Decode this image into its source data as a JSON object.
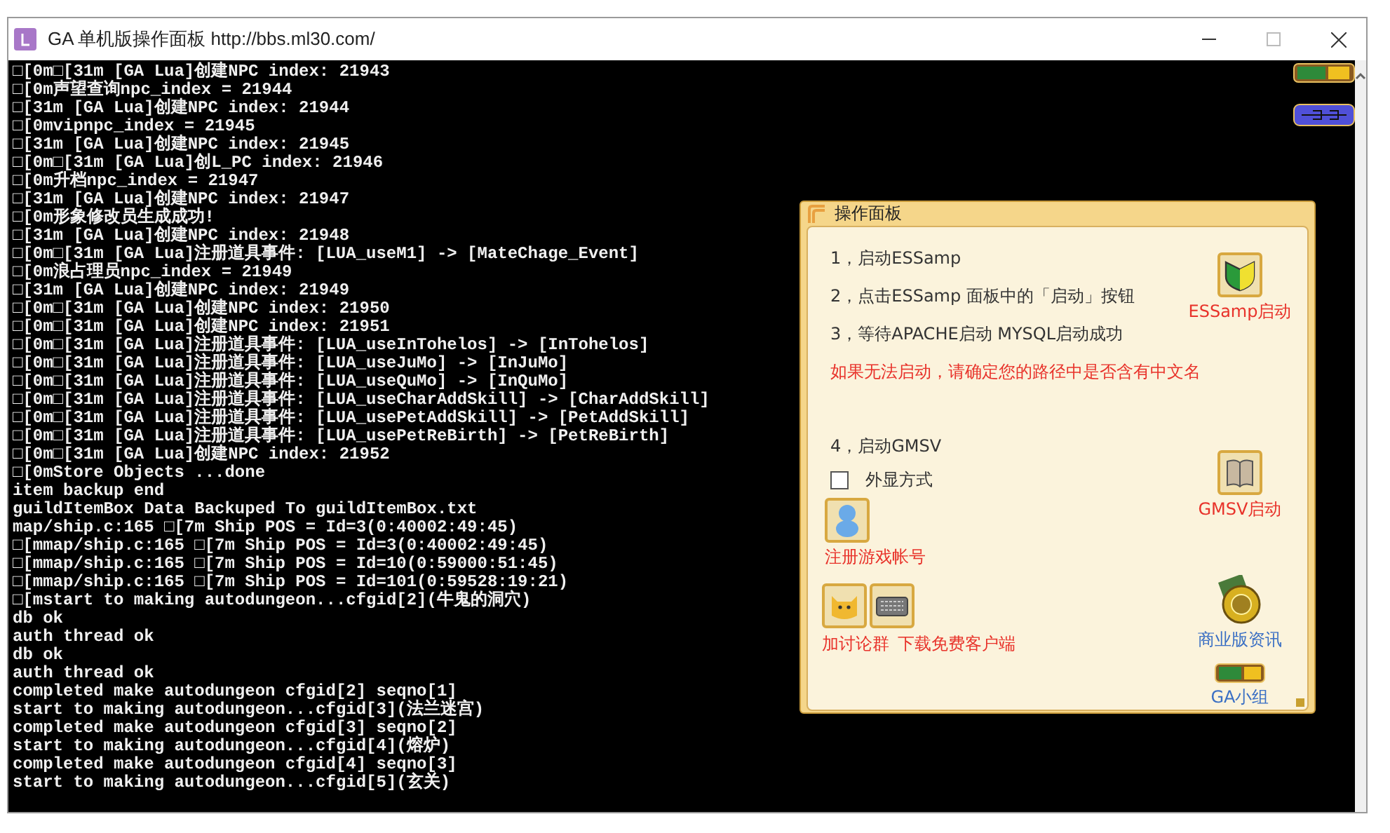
{
  "window": {
    "title": "GA 单机版操作面板 http://bbs.ml30.com/"
  },
  "console": {
    "lines": [
      "□[0m□[31m [GA Lua]创建NPC index: 21943",
      "□[0m声望查询npc_index = 21944",
      "□[31m [GA Lua]创建NPC index: 21944",
      "□[0mvipnpc_index = 21945",
      "□[31m [GA Lua]创建NPC index: 21945",
      "□[0m□[31m [GA Lua]创L_PC index: 21946",
      "□[0m升档npc_index = 21947",
      "□[31m [GA Lua]创建NPC index: 21947",
      "□[0m形象修改员生成成功!",
      "□[31m [GA Lua]创建NPC index: 21948",
      "□[0m□[31m [GA Lua]注册道具事件: [LUA_useM1] -> [MateChage_Event]",
      "□[0m浪占理员npc_index = 21949",
      "□[31m [GA Lua]创建NPC index: 21949",
      "□[0m□[31m [GA Lua]创建NPC index: 21950",
      "□[0m□[31m [GA Lua]创建NPC index: 21951",
      "□[0m□[31m [GA Lua]注册道具事件: [LUA_useInTohelos] -> [InTohelos]",
      "□[0m□[31m [GA Lua]注册道具事件: [LUA_useJuMo] -> [InJuMo]",
      "□[0m□[31m [GA Lua]注册道具事件: [LUA_useQuMo] -> [InQuMo]",
      "□[0m□[31m [GA Lua]注册道具事件: [LUA_useCharAddSkill] -> [CharAddSkill]",
      "□[0m□[31m [GA Lua]注册道具事件: [LUA_usePetAddSkill] -> [PetAddSkill]",
      "□[0m□[31m [GA Lua]注册道具事件: [LUA_usePetReBirth] -> [PetReBirth]",
      "□[0m□[31m [GA Lua]创建NPC index: 21952",
      "□[0mStore Objects ...done",
      "item backup end",
      "guildItemBox Data Backuped To guildItemBox.txt",
      "map/ship.c:165 □[7m Ship POS = Id=3(0:40002:49:45)",
      "□[mmap/ship.c:165 □[7m Ship POS = Id=3(0:40002:49:45)",
      "□[mmap/ship.c:165 □[7m Ship POS = Id=10(0:59000:51:45)",
      "□[mmap/ship.c:165 □[7m Ship POS = Id=101(0:59528:19:21)",
      "□[mstart to making autodungeon...cfgid[2](牛鬼的洞穴)",
      "db ok",
      "auth thread ok",
      "db ok",
      "auth thread ok",
      "completed make autodungeon cfgid[2] seqno[1]",
      "start to making autodungeon...cfgid[3](法兰迷宫)",
      "completed make autodungeon cfgid[3] seqno[2]",
      "start to making autodungeon...cfgid[4](熔炉)",
      "completed make autodungeon cfgid[4] seqno[3]",
      "start to making autodungeon...cfgid[5](玄关)"
    ]
  },
  "panel": {
    "title": "操作面板",
    "steps": [
      "1，启动ESSamp",
      "2，点击ESSamp 面板中的「启动」按钮",
      "3，等待APACHE启动 MYSQL启动成功"
    ],
    "warning": "如果无法启动，请确定您的路径中是否含有中文名",
    "step4": "4，启动GMSV",
    "checkbox": {
      "label": "外显方式",
      "checked": false
    },
    "register": {
      "kind": "person",
      "label": "注册游戏帐号"
    },
    "links": [
      {
        "kind": "cat",
        "label": "加讨论群"
      },
      {
        "kind": "keyboard",
        "label": "下载免费客户端"
      }
    ],
    "side_buttons": [
      {
        "kind": "shield",
        "label": "ESSamp启动",
        "color": "#e8322a"
      },
      {
        "kind": "book",
        "label": "GMSV启动",
        "color": "#e8322a"
      },
      {
        "kind": "medal",
        "label": "商业版资讯",
        "color": "#3a6fc4"
      },
      {
        "kind": "banner",
        "label": "GA小组",
        "color": "#3a6fc4"
      }
    ]
  }
}
